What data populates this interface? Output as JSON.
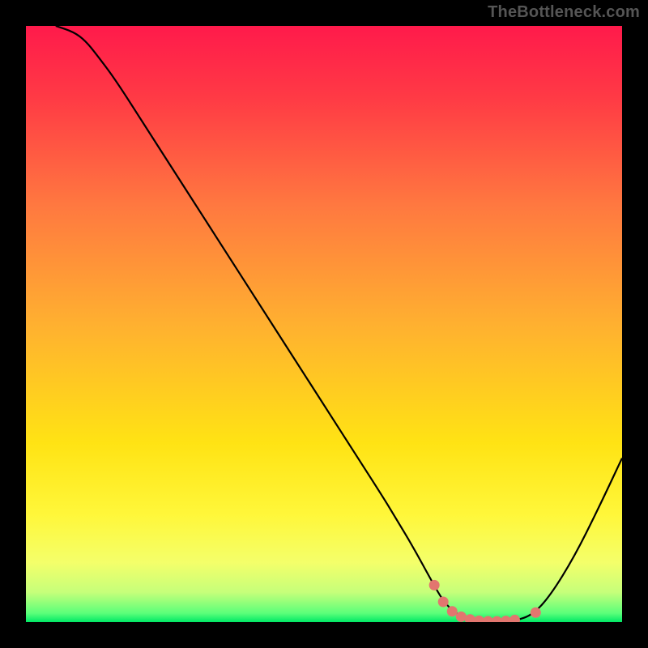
{
  "watermark": "TheBottleneck.com",
  "chart_data": {
    "type": "line",
    "title": "",
    "xlabel": "",
    "ylabel": "",
    "xlim": [
      0,
      100
    ],
    "ylim": [
      0,
      100
    ],
    "grid": false,
    "legend": false,
    "background": {
      "type": "vertical-gradient",
      "stops": [
        {
          "pos": 0.0,
          "color": "#ff1a4b"
        },
        {
          "pos": 0.12,
          "color": "#ff3a45"
        },
        {
          "pos": 0.3,
          "color": "#ff7840"
        },
        {
          "pos": 0.5,
          "color": "#ffb030"
        },
        {
          "pos": 0.7,
          "color": "#ffe314"
        },
        {
          "pos": 0.82,
          "color": "#fff73a"
        },
        {
          "pos": 0.9,
          "color": "#f4ff6a"
        },
        {
          "pos": 0.95,
          "color": "#c6ff7a"
        },
        {
          "pos": 0.985,
          "color": "#5cff7a"
        },
        {
          "pos": 1.0,
          "color": "#00e865"
        }
      ]
    },
    "series": [
      {
        "name": "bottleneck-curve",
        "color": "#000000",
        "width": 2.2,
        "x": [
          5,
          8,
          10,
          12,
          15,
          20,
          25,
          30,
          35,
          40,
          45,
          50,
          55,
          60,
          62,
          65,
          68,
          70,
          72,
          74,
          76,
          78,
          80,
          82,
          85,
          88,
          92,
          96,
          100
        ],
        "y": [
          100,
          99,
          97.5,
          95,
          91,
          83.2,
          75.4,
          67.6,
          59.8,
          52.0,
          44.2,
          36.4,
          28.6,
          20.8,
          17.5,
          12.5,
          7.0,
          3.5,
          1.5,
          0.6,
          0.2,
          0.1,
          0.1,
          0.2,
          1.2,
          4.5,
          11.0,
          19.0,
          27.5
        ]
      }
    ],
    "markers": {
      "name": "optimal-region",
      "color": "#e2766f",
      "radius": 6.5,
      "points": [
        {
          "x": 68.5,
          "y": 6.2
        },
        {
          "x": 70.0,
          "y": 3.4
        },
        {
          "x": 71.5,
          "y": 1.8
        },
        {
          "x": 73.0,
          "y": 0.9
        },
        {
          "x": 74.5,
          "y": 0.45
        },
        {
          "x": 76.0,
          "y": 0.22
        },
        {
          "x": 77.5,
          "y": 0.14
        },
        {
          "x": 79.0,
          "y": 0.12
        },
        {
          "x": 80.5,
          "y": 0.18
        },
        {
          "x": 82.0,
          "y": 0.35
        },
        {
          "x": 85.5,
          "y": 1.6
        }
      ]
    }
  }
}
